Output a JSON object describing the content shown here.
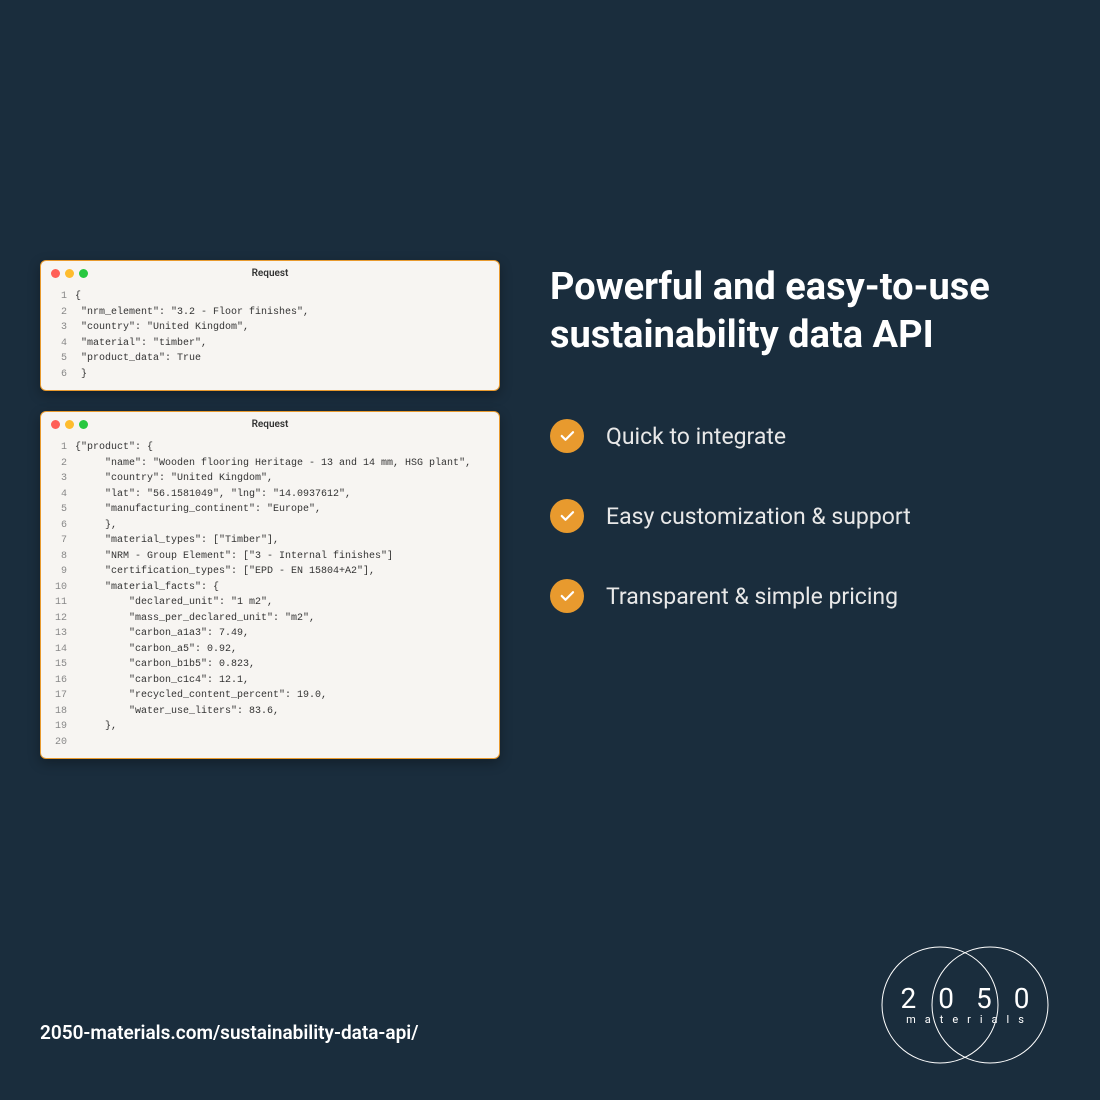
{
  "window1": {
    "title": "Request",
    "lines": [
      "{",
      " \"nrm_element\": \"3.2 - Floor finishes\",",
      " \"country\": \"United Kingdom\",",
      " \"material\": \"timber\",",
      " \"product_data\": True",
      " }"
    ]
  },
  "window2": {
    "title": "Request",
    "lines": [
      "{\"product\": {",
      "     \"name\": \"Wooden flooring Heritage - 13 and 14 mm, HSG plant\",",
      "     \"country\": \"United Kingdom\",",
      "     \"lat\": \"56.1581049\", \"lng\": \"14.0937612\",",
      "     \"manufacturing_continent\": \"Europe\",",
      "     },",
      "     \"material_types\": [\"Timber\"],",
      "     \"NRM - Group Element\": [\"3 - Internal finishes\"]",
      "     \"certification_types\": [\"EPD - EN 15804+A2\"],",
      "     \"material_facts\": {",
      "         \"declared_unit\": \"1 m2\",",
      "         \"mass_per_declared_unit\": \"m2\",",
      "         \"carbon_a1a3\": 7.49,",
      "         \"carbon_a5\": 0.92,",
      "         \"carbon_b1b5\": 0.823,",
      "         \"carbon_c1c4\": 12.1,",
      "         \"recycled_content_percent\": 19.0,",
      "         \"water_use_liters\": 83.6,",
      "     },",
      ""
    ]
  },
  "headline": "Powerful and easy-to-use sustainability data API",
  "features": [
    "Quick to integrate",
    "Easy customization & support",
    "Transparent & simple pricing"
  ],
  "footer_url": "2050-materials.com/sustainability-data-api/",
  "logo": {
    "digits": "2050",
    "sub": "materials"
  },
  "colors": {
    "accent": "#e89a2e",
    "bg": "#1a2d3d"
  }
}
